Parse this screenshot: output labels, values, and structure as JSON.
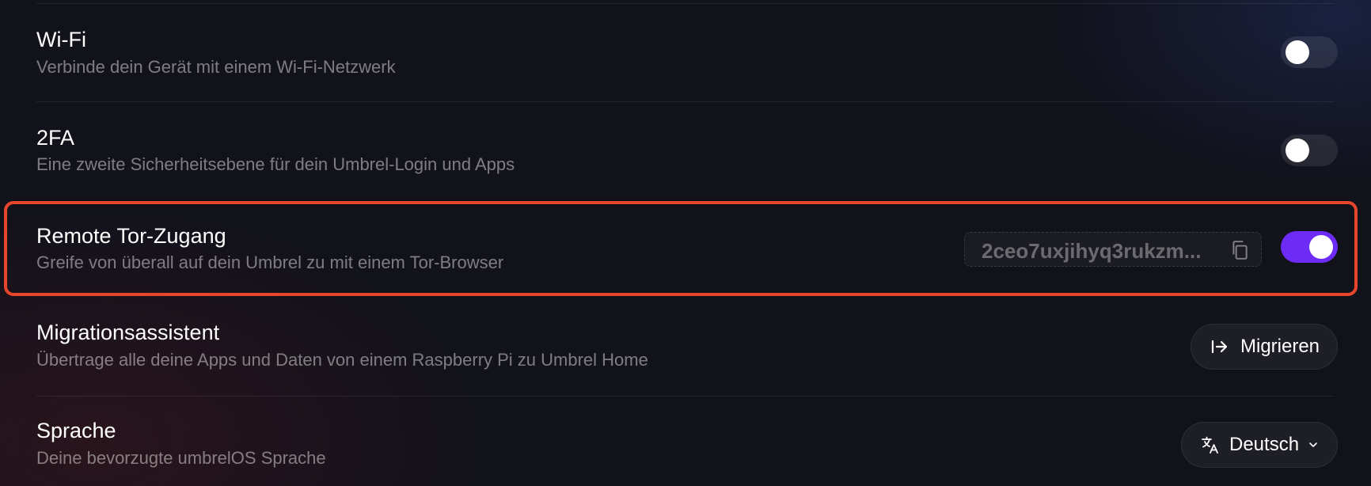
{
  "settings": {
    "wifi": {
      "title": "Wi-Fi",
      "description": "Verbinde dein Gerät mit einem Wi-Fi-Netzwerk",
      "enabled": false
    },
    "twofa": {
      "title": "2FA",
      "description": "Eine zweite Sicherheitsebene für dein Umbrel-Login und Apps",
      "enabled": false
    },
    "tor": {
      "title": "Remote Tor-Zugang",
      "description": "Greife von überall auf dein Umbrel zu mit einem Tor-Browser",
      "address": "2ceo7uxjihyq3rukzm...",
      "enabled": true
    },
    "migration": {
      "title": "Migrationsassistent",
      "description": "Übertrage alle deine Apps und Daten von einem Raspberry Pi zu Umbrel Home",
      "button_label": "Migrieren",
      "button_icon": "migrate-arrow-icon"
    },
    "language": {
      "title": "Sprache",
      "description": "Deine bevorzugte umbrelOS Sprache",
      "selected": "Deutsch",
      "button_icon": "translate-icon"
    }
  },
  "colors": {
    "highlight": "#e8462c",
    "toggle_on": "#6c2cf5"
  }
}
